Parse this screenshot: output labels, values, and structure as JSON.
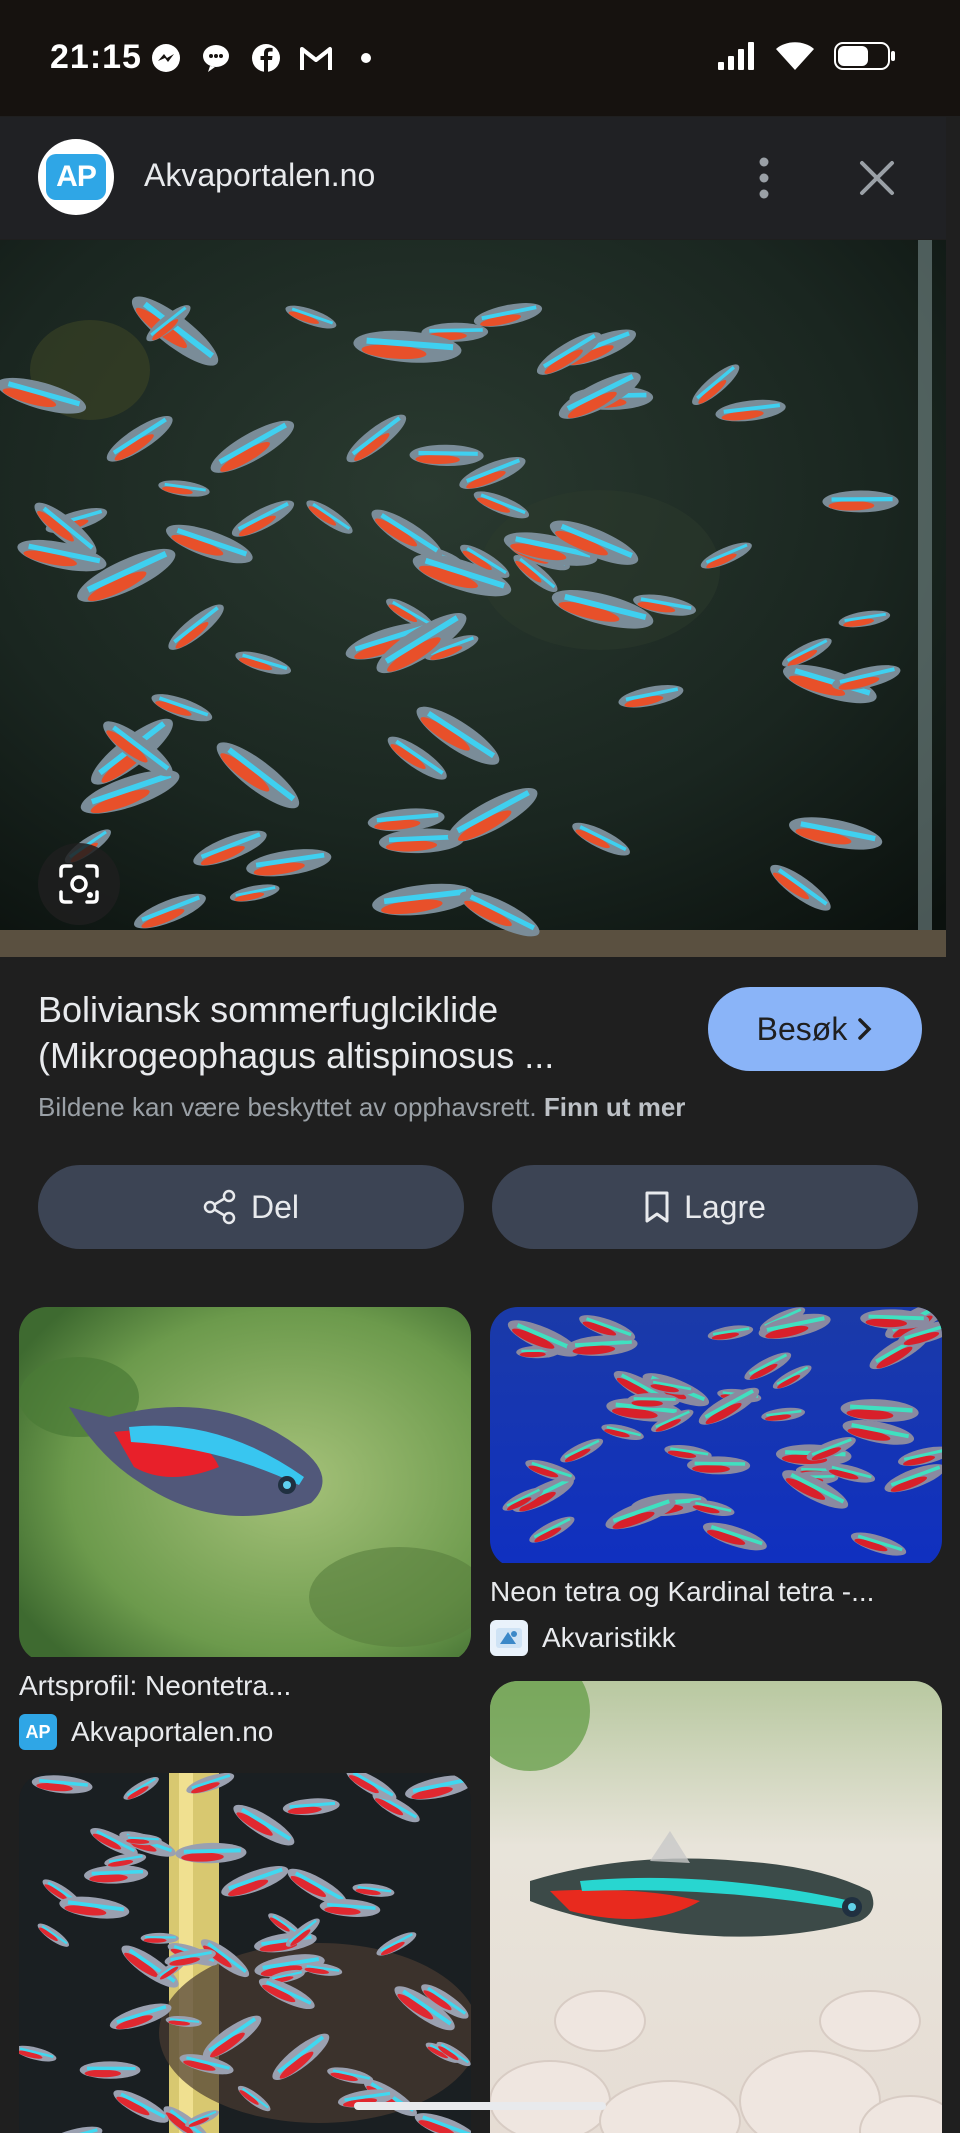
{
  "status_bar": {
    "time": "21:15",
    "notification_icons": [
      "messenger-icon",
      "threads-icon",
      "facebook-icon",
      "gmail-icon",
      "dot-icon"
    ],
    "system_icons": [
      "signal-icon",
      "wifi-icon",
      "battery-icon"
    ]
  },
  "header": {
    "site_logo_text": "AP",
    "site_name": "Akvaportalen.no"
  },
  "result": {
    "title": "Boliviansk sommerfuglciklide (Mikrogeophagus altispinosus ...",
    "visit_label": "Besøk",
    "copyright_text": "Bildene kan være beskyttet av opphavsrett.",
    "learn_more_label": "Finn ut mer",
    "share_label": "Del",
    "save_label": "Lagre"
  },
  "related": [
    {
      "title": "Artsprofil: Neontetra...",
      "source": "Akvaportalen.no",
      "source_logo": "AP"
    },
    {
      "title": "Neon tetra og Kardinal tetra -...",
      "source": "Akvaristikk",
      "source_logo": "akvaristikk-logo"
    },
    {
      "title": "",
      "source": ""
    },
    {
      "title": "",
      "source": ""
    }
  ],
  "colors": {
    "background": "#1f1f1f",
    "accent_button": "#8ab4f8",
    "secondary_button": "#3c4454",
    "ap_logo": "#2fa6e6"
  }
}
